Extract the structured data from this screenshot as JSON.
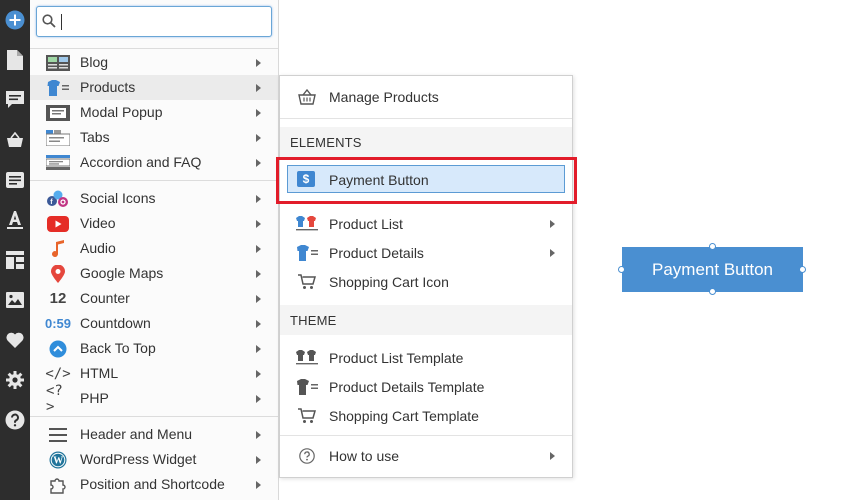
{
  "search": {
    "value": "",
    "placeholder": ""
  },
  "menu": {
    "group1": [
      {
        "label": "Blog",
        "icon": "blog-icon"
      },
      {
        "label": "Products",
        "icon": "products-icon"
      },
      {
        "label": "Modal Popup",
        "icon": "modal-popup-icon"
      },
      {
        "label": "Tabs",
        "icon": "tabs-icon"
      },
      {
        "label": "Accordion and FAQ",
        "icon": "accordion-icon"
      }
    ],
    "group2": [
      {
        "label": "Social Icons",
        "icon": "social-icons-icon"
      },
      {
        "label": "Video",
        "icon": "video-icon"
      },
      {
        "label": "Audio",
        "icon": "audio-icon"
      },
      {
        "label": "Google Maps",
        "icon": "map-pin-icon"
      },
      {
        "label": "Counter",
        "icon": "counter-icon",
        "glyph": "12"
      },
      {
        "label": "Countdown",
        "icon": "countdown-icon",
        "glyph": "0:59"
      },
      {
        "label": "Back To Top",
        "icon": "back-to-top-icon"
      },
      {
        "label": "HTML",
        "icon": "html-code-icon",
        "glyph": "</>"
      },
      {
        "label": "PHP",
        "icon": "php-code-icon",
        "glyph": "<?>"
      }
    ],
    "group3": [
      {
        "label": "Header and Menu",
        "icon": "hamburger-icon"
      },
      {
        "label": "WordPress Widget",
        "icon": "wordpress-icon"
      },
      {
        "label": "Position and Shortcode",
        "icon": "puzzle-icon"
      }
    ]
  },
  "submenu": {
    "manage": "Manage Products",
    "elements_heading": "ELEMENTS",
    "payment_button": "Payment Button",
    "payment_icon_glyph": "$",
    "product_list": "Product List",
    "product_details": "Product Details",
    "shopping_cart_icon": "Shopping Cart Icon",
    "theme_heading": "THEME",
    "product_list_template": "Product List Template",
    "product_details_template": "Product Details Template",
    "shopping_cart_template": "Shopping Cart Template",
    "how_to_use": "How to use"
  },
  "canvas": {
    "button_label": "Payment Button"
  },
  "colors": {
    "accent": "#4a8fd1",
    "highlight_border": "#e21c2a",
    "rail": "#2d2d2d"
  }
}
